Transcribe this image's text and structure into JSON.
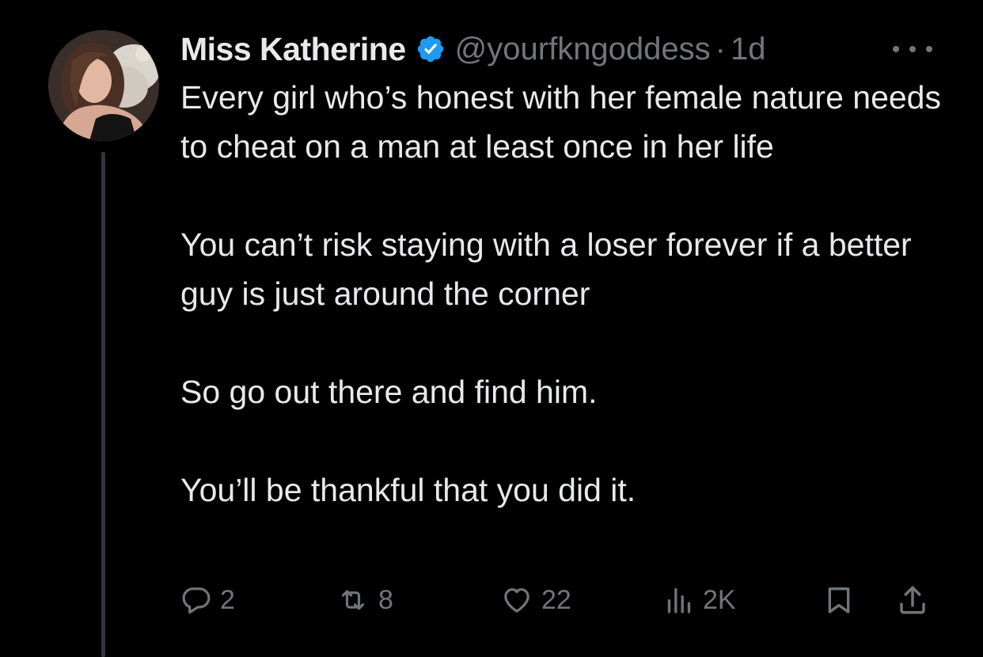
{
  "tweet": {
    "author": {
      "display_name": "Miss Katherine",
      "handle": "@yourfkngoddess",
      "verified": true
    },
    "separator": "·",
    "time": "1d",
    "text": [
      "Every girl who’s honest with her female nature needs to cheat on a man at least once in her life",
      "You can’t risk staying with a loser forever if a better guy is just around the corner",
      "So go out there and find him.",
      "You’ll be thankful that you did it."
    ],
    "stats": {
      "replies": "2",
      "reposts": "8",
      "likes": "22",
      "views": "2K"
    }
  },
  "icons": {
    "verified": "verified-badge-icon",
    "more": "more-icon",
    "reply": "reply-icon",
    "repost": "repost-icon",
    "like": "heart-icon",
    "views": "views-icon",
    "bookmark": "bookmark-icon",
    "share": "share-icon"
  },
  "colors": {
    "background": "#000000",
    "text_primary": "#e7e9ea",
    "text_secondary": "#71767b",
    "verified_blue": "#1d9bf0",
    "thread_line": "#333639"
  }
}
